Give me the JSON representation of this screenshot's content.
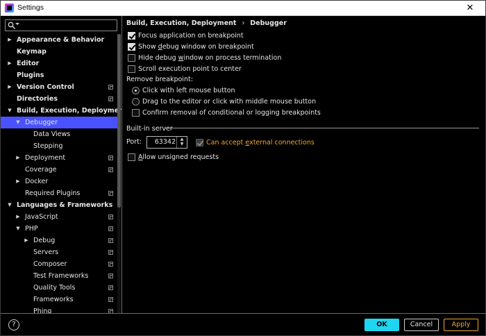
{
  "window": {
    "title": "Settings",
    "close_glyph": "✕"
  },
  "search": {
    "value": ""
  },
  "sidebar": {
    "items": [
      {
        "label": "Appearance & Behavior",
        "bold": true,
        "arrow": "right",
        "indent": 0
      },
      {
        "label": "Keymap",
        "bold": true,
        "arrow": "",
        "indent": 0
      },
      {
        "label": "Editor",
        "bold": true,
        "arrow": "right",
        "indent": 0
      },
      {
        "label": "Plugins",
        "bold": true,
        "arrow": "",
        "indent": 0
      },
      {
        "label": "Version Control",
        "bold": true,
        "arrow": "right",
        "indent": 0,
        "project": true
      },
      {
        "label": "Directories",
        "bold": true,
        "arrow": "",
        "indent": 0,
        "project": true
      },
      {
        "label": "Build, Execution, Deployment",
        "bold": true,
        "arrow": "down",
        "indent": 0
      },
      {
        "label": "Debugger",
        "bold": false,
        "arrow": "down",
        "indent": 1,
        "selected": true
      },
      {
        "label": "Data Views",
        "bold": false,
        "arrow": "",
        "indent": 2
      },
      {
        "label": "Stepping",
        "bold": false,
        "arrow": "",
        "indent": 2
      },
      {
        "label": "Deployment",
        "bold": false,
        "arrow": "right",
        "indent": 1,
        "project": true
      },
      {
        "label": "Coverage",
        "bold": false,
        "arrow": "",
        "indent": 1,
        "project": true
      },
      {
        "label": "Docker",
        "bold": false,
        "arrow": "right",
        "indent": 1
      },
      {
        "label": "Required Plugins",
        "bold": false,
        "arrow": "",
        "indent": 1,
        "project": true
      },
      {
        "label": "Languages & Frameworks",
        "bold": true,
        "arrow": "down",
        "indent": 0
      },
      {
        "label": "JavaScript",
        "bold": false,
        "arrow": "right",
        "indent": 1,
        "project": true
      },
      {
        "label": "PHP",
        "bold": false,
        "arrow": "down",
        "indent": 1,
        "project": true
      },
      {
        "label": "Debug",
        "bold": false,
        "arrow": "right",
        "indent": 2,
        "project": true
      },
      {
        "label": "Servers",
        "bold": false,
        "arrow": "",
        "indent": 2,
        "project": true
      },
      {
        "label": "Composer",
        "bold": false,
        "arrow": "",
        "indent": 2,
        "project": true
      },
      {
        "label": "Test Frameworks",
        "bold": false,
        "arrow": "",
        "indent": 2,
        "project": true
      },
      {
        "label": "Quality Tools",
        "bold": false,
        "arrow": "",
        "indent": 2,
        "project": true
      },
      {
        "label": "Frameworks",
        "bold": false,
        "arrow": "",
        "indent": 2,
        "project": true
      },
      {
        "label": "Phing",
        "bold": false,
        "arrow": "",
        "indent": 2,
        "project": true
      }
    ]
  },
  "breadcrumb": {
    "parent": "Build, Execution, Deployment",
    "separator": "›",
    "current": "Debugger"
  },
  "options": {
    "focus_app": {
      "label": "Focus application on breakpoint",
      "checked": true
    },
    "show_debug_pre": "Show ",
    "show_debug_u": "d",
    "show_debug_post": "ebug window on breakpoint",
    "hide_debug_pre": "Hide debug ",
    "hide_debug_u": "w",
    "hide_debug_post": "indow on process termination",
    "scroll_exec": {
      "label": "Scroll execution point to center",
      "checked": false
    },
    "remove_breakpoint_label": "Remove breakpoint:",
    "click_left": "Click with left mouse button",
    "drag_editor": "Drag to the editor or click with middle mouse button",
    "confirm_removal": "Confirm removal of conditional or logging breakpoints"
  },
  "builtin_server": {
    "section_label": "Built-in server",
    "port_label": "Port:",
    "port_value": "63342",
    "can_accept_pre": "Can accept ",
    "can_accept_u": "e",
    "can_accept_post": "xternal connections",
    "allow_u": "A",
    "allow_post": "llow unsigned requests"
  },
  "footer": {
    "help_glyph": "?",
    "ok": "OK",
    "cancel": "Cancel",
    "apply": "Apply"
  },
  "colors": {
    "selection": "#4a52ff",
    "accent": "#1ed6f0",
    "warning": "#f0a732"
  }
}
